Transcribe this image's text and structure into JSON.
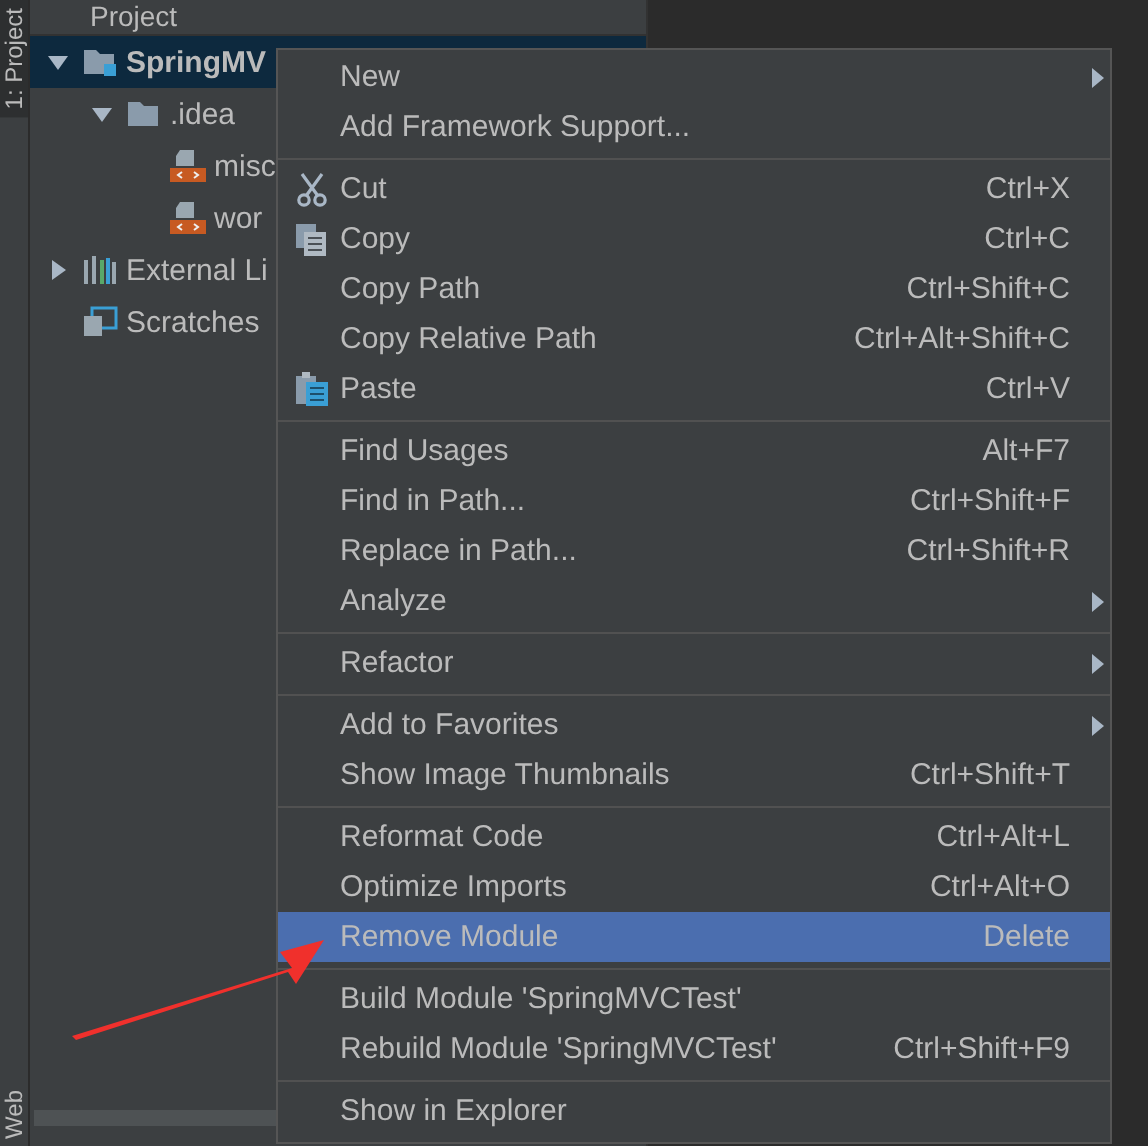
{
  "sidebar": {
    "top_tab": "1: Project",
    "bottom_tab": "Web"
  },
  "project_panel": {
    "title": "Project",
    "tree": [
      {
        "label": "SpringMV",
        "kind": "module",
        "expanded": true,
        "selected": true,
        "children": [
          {
            "label": ".idea",
            "kind": "folder",
            "expanded": true,
            "selected": false,
            "children": [
              {
                "label": "misc",
                "kind": "xml",
                "selected": false
              },
              {
                "label": "wor",
                "kind": "xml",
                "selected": false
              }
            ]
          }
        ]
      },
      {
        "label": "External Li",
        "kind": "libraries",
        "expanded": false,
        "selected": false
      },
      {
        "label": "Scratches",
        "kind": "scratches",
        "selected": false
      }
    ]
  },
  "context_menu": {
    "groups": [
      [
        {
          "label": "New",
          "submenu": true,
          "selected": false
        },
        {
          "label": "Add Framework Support...",
          "submenu": false,
          "selected": false
        }
      ],
      [
        {
          "label": "Cut",
          "kind": "cut",
          "shortcut": "Ctrl+X",
          "submenu": false,
          "selected": false
        },
        {
          "label": "Copy",
          "kind": "copy",
          "shortcut": "Ctrl+C",
          "submenu": false,
          "selected": false
        },
        {
          "label": "Copy Path",
          "shortcut": "Ctrl+Shift+C",
          "submenu": false,
          "selected": false
        },
        {
          "label": "Copy Relative Path",
          "shortcut": "Ctrl+Alt+Shift+C",
          "submenu": false,
          "selected": false
        },
        {
          "label": "Paste",
          "kind": "paste",
          "shortcut": "Ctrl+V",
          "submenu": false,
          "selected": false
        }
      ],
      [
        {
          "label": "Find Usages",
          "shortcut": "Alt+F7",
          "submenu": false,
          "selected": false
        },
        {
          "label": "Find in Path...",
          "shortcut": "Ctrl+Shift+F",
          "submenu": false,
          "selected": false
        },
        {
          "label": "Replace in Path...",
          "shortcut": "Ctrl+Shift+R",
          "submenu": false,
          "selected": false
        },
        {
          "label": "Analyze",
          "submenu": true,
          "selected": false
        }
      ],
      [
        {
          "label": "Refactor",
          "submenu": true,
          "selected": false
        }
      ],
      [
        {
          "label": "Add to Favorites",
          "submenu": true,
          "selected": false
        },
        {
          "label": "Show Image Thumbnails",
          "shortcut": "Ctrl+Shift+T",
          "submenu": false,
          "selected": false
        }
      ],
      [
        {
          "label": "Reformat Code",
          "shortcut": "Ctrl+Alt+L",
          "submenu": false,
          "selected": false
        },
        {
          "label": "Optimize Imports",
          "shortcut": "Ctrl+Alt+O",
          "submenu": false,
          "selected": false
        },
        {
          "label": "Remove Module",
          "shortcut": "Delete",
          "submenu": false,
          "selected": true
        }
      ],
      [
        {
          "label": "Build Module 'SpringMVCTest'",
          "submenu": false,
          "selected": false
        },
        {
          "label": "Rebuild Module 'SpringMVCTest'",
          "shortcut": "Ctrl+Shift+F9",
          "submenu": false,
          "selected": false
        }
      ],
      [
        {
          "label": "Show in Explorer",
          "submenu": false,
          "selected": false
        }
      ]
    ]
  }
}
